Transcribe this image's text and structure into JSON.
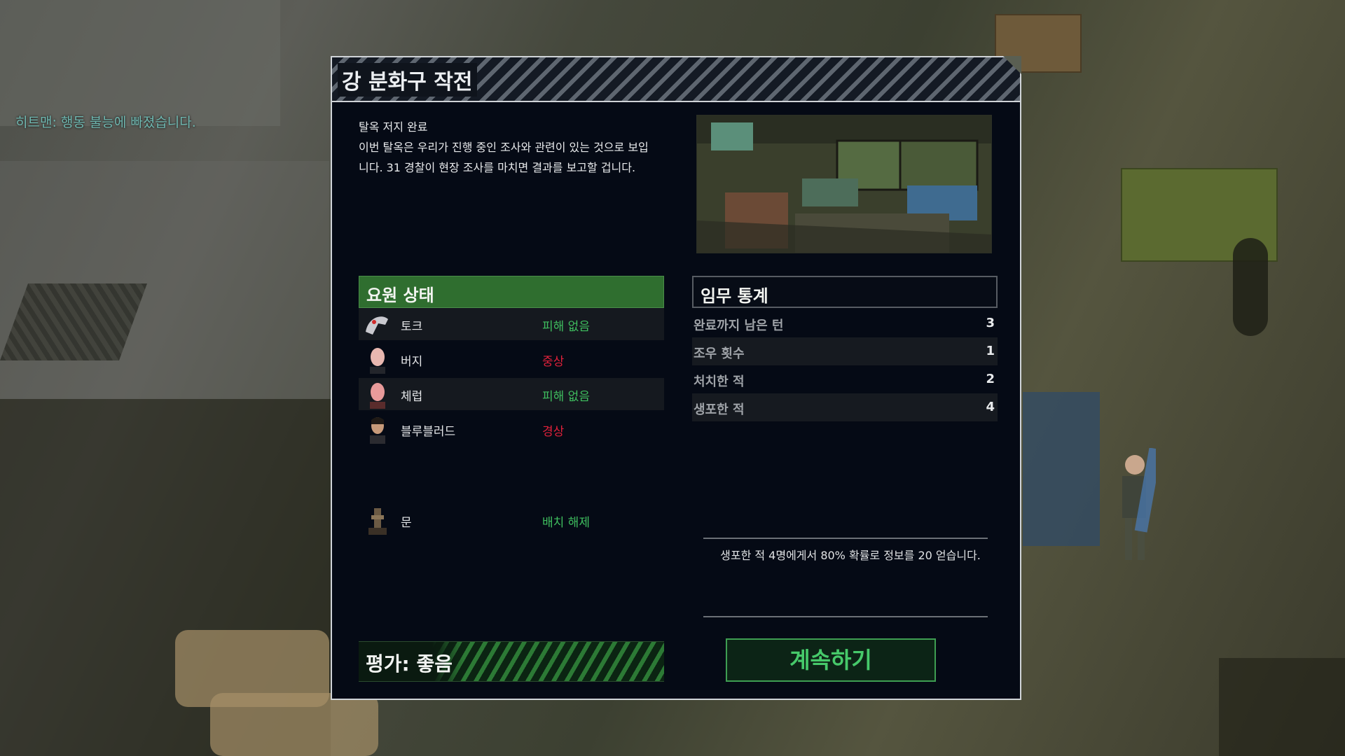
{
  "notice": "히트맨: 행동 불능에 빠졌습니다.",
  "dialog": {
    "title": "강 분화구 작전",
    "brief_title": "탈옥 저지 완료",
    "brief_body": "이번 탈옥은 우리가 진행 중인 조사와 관련이 있는 것으로 보입니다. 31 경찰이 현장 조사를 마치면 결과를 보고할 겁니다."
  },
  "agents": {
    "header": "요원 상태",
    "list": [
      {
        "name": "토크",
        "status": "피해 없음",
        "status_color": "#3fbf5f",
        "icon": "agent-torque-portrait"
      },
      {
        "name": "버지",
        "status": "중상",
        "status_color": "#e0213a",
        "icon": "agent-verge-portrait"
      },
      {
        "name": "체럽",
        "status": "피해 없음",
        "status_color": "#3fbf5f",
        "icon": "agent-cherub-portrait"
      },
      {
        "name": "블루블러드",
        "status": "경상",
        "status_color": "#e0213a",
        "icon": "agent-blueblood-portrait"
      },
      {
        "name": "문",
        "status": "배치 해제",
        "status_color": "#3fbf5f",
        "icon": "agent-moon-portrait"
      }
    ]
  },
  "stats": {
    "header": "임무 통계",
    "rows": [
      {
        "label": "완료까지 남은 턴",
        "value": "3"
      },
      {
        "label": "조우 횟수",
        "value": "1"
      },
      {
        "label": "처치한 적",
        "value": "2"
      },
      {
        "label": "생포한 적",
        "value": "4"
      }
    ]
  },
  "intel_line": "생포한 적 4명에게서 80% 확률로 정보를 20 얻습니다.",
  "rating": "평가: 좋음",
  "continue_label": "계속하기",
  "colors": {
    "accent_green": "#3fbf5f",
    "danger_red": "#e0213a",
    "header_green": "#2f6e2f"
  }
}
